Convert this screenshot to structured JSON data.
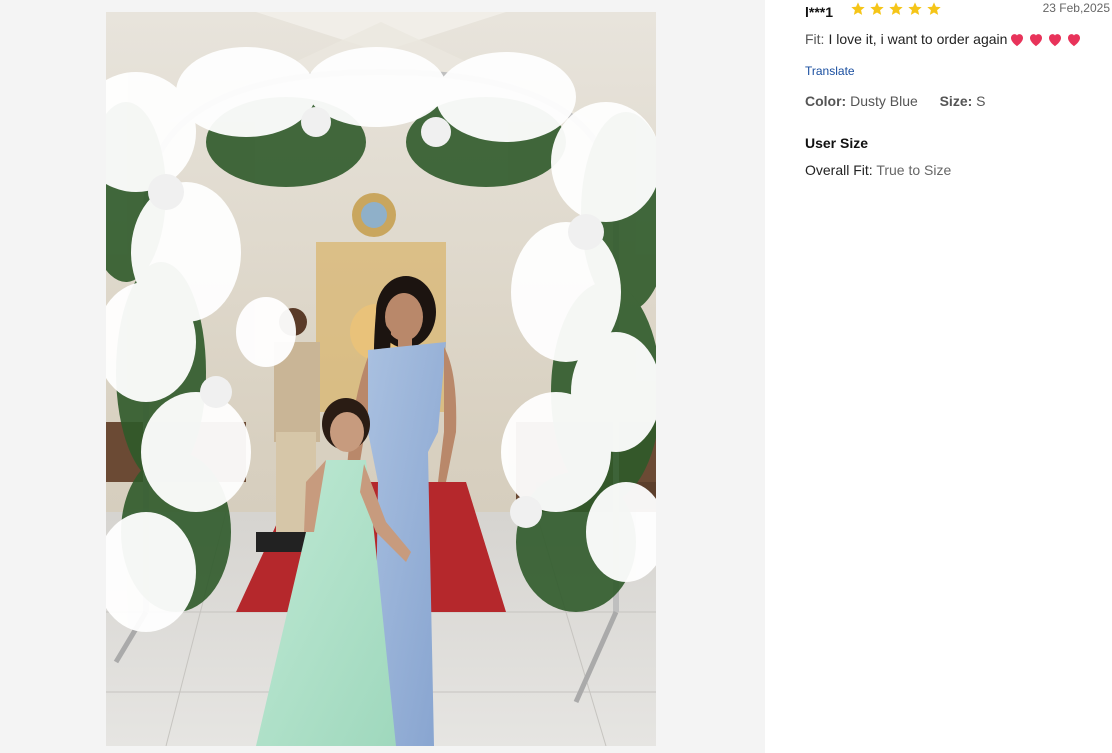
{
  "review": {
    "username": "l***1",
    "rating": 5,
    "date": "23 Feb,2025",
    "fit_label": "Fit:",
    "fit_text": "I love it, i want to order again",
    "fit_emoji_count": 4,
    "translate_label": "Translate",
    "color_label": "Color:",
    "color_value": "Dusty Blue",
    "size_label": "Size:",
    "size_value": "S",
    "user_size_title": "User Size",
    "overall_fit_label": "Overall Fit:",
    "overall_fit_value": "True to Size"
  },
  "icons": {
    "star": "star-icon",
    "heart": "heart-icon"
  },
  "colors": {
    "star": "#f5c518",
    "heart": "#e8335a",
    "link": "#1a4fa0",
    "panel_bg": "#f4f4f4"
  }
}
